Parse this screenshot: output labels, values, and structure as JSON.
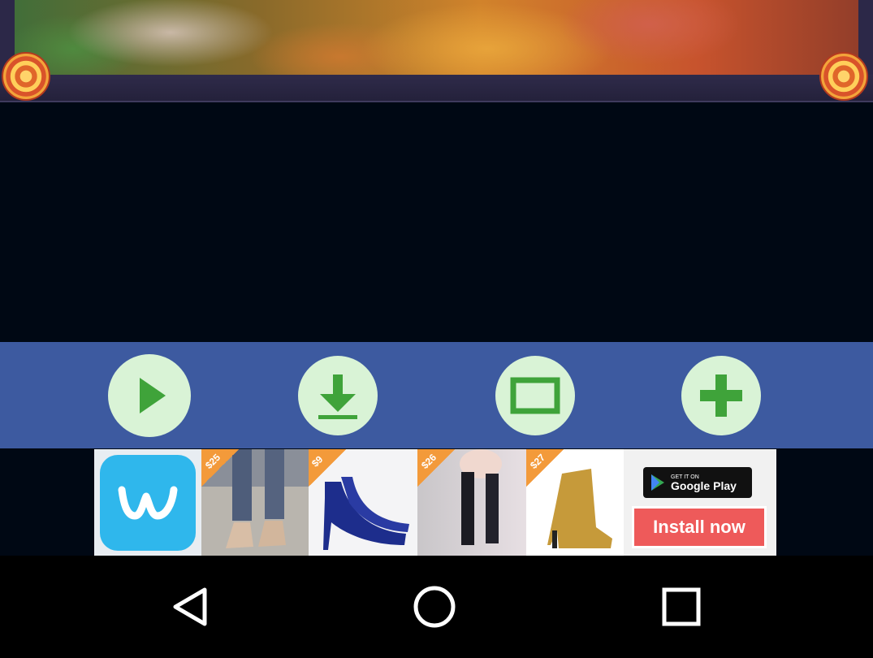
{
  "controls": {
    "icons": [
      "play-icon",
      "download-icon",
      "fullscreen-icon",
      "add-icon"
    ],
    "bar_color": "#3d5aa0",
    "button_color": "#d9f3d6",
    "icon_color": "#3fa33a"
  },
  "ad": {
    "prices": [
      "$25",
      "$9",
      "$26",
      "$27"
    ],
    "badge_small": "GET IT ON",
    "badge_big": "Google Play",
    "install_label": "Install now",
    "install_color": "#ee5a5a",
    "brand_color": "#2fb7ec"
  },
  "navbar": {
    "icons": [
      "back-icon",
      "home-icon",
      "recents-icon"
    ]
  }
}
